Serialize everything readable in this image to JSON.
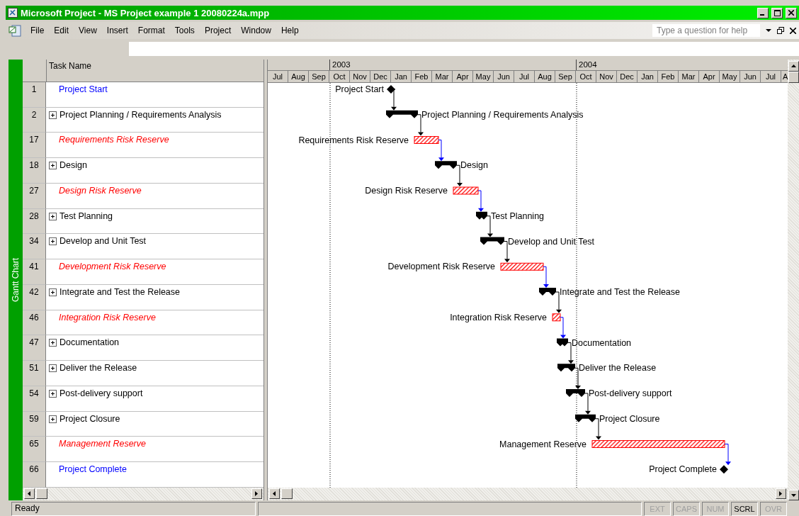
{
  "window": {
    "title": "Microsoft Project - MS Project example 1 20080224a.mpp"
  },
  "menu": [
    "File",
    "Edit",
    "View",
    "Insert",
    "Format",
    "Tools",
    "Project",
    "Window",
    "Help"
  ],
  "help_box": {
    "placeholder": "Type a question for help"
  },
  "view_bar": {
    "label": "Gantt Chart"
  },
  "table": {
    "columns": [
      "Task Name"
    ],
    "rows": [
      {
        "id": "1",
        "name": "Project Start",
        "kind": "milestone"
      },
      {
        "id": "2",
        "name": "Project Planning / Requirements Analysis",
        "kind": "summary",
        "expanded": false
      },
      {
        "id": "17",
        "name": "Requirements Risk Reserve",
        "kind": "reserve"
      },
      {
        "id": "18",
        "name": "Design",
        "kind": "summary",
        "expanded": false
      },
      {
        "id": "27",
        "name": "Design Risk Reserve",
        "kind": "reserve"
      },
      {
        "id": "28",
        "name": "Test Planning",
        "kind": "summary",
        "expanded": false
      },
      {
        "id": "34",
        "name": "Develop and Unit Test",
        "kind": "summary",
        "expanded": false
      },
      {
        "id": "41",
        "name": "Development Risk Reserve",
        "kind": "reserve"
      },
      {
        "id": "42",
        "name": "Integrate and Test the Release",
        "kind": "summary",
        "expanded": false
      },
      {
        "id": "46",
        "name": "Integration Risk Reserve",
        "kind": "reserve"
      },
      {
        "id": "47",
        "name": "Documentation",
        "kind": "summary",
        "expanded": false
      },
      {
        "id": "51",
        "name": "Deliver the Release",
        "kind": "summary",
        "expanded": false
      },
      {
        "id": "54",
        "name": "Post-delivery support",
        "kind": "summary",
        "expanded": false
      },
      {
        "id": "59",
        "name": "Project Closure",
        "kind": "summary",
        "expanded": false
      },
      {
        "id": "65",
        "name": "Management Reserve",
        "kind": "reserve"
      },
      {
        "id": "66",
        "name": "Project Complete",
        "kind": "milestone"
      }
    ]
  },
  "timescale": {
    "years": [
      "2003",
      "2004"
    ],
    "months": [
      "Jul",
      "Aug",
      "Sep",
      "Oct",
      "Nov",
      "Dec",
      "Jan",
      "Feb",
      "Mar",
      "Apr",
      "May",
      "Jun",
      "Jul",
      "Aug",
      "Sep",
      "Oct",
      "Nov",
      "Dec",
      "Jan",
      "Feb",
      "Mar",
      "Apr",
      "May",
      "Jun",
      "Jul",
      "A"
    ]
  },
  "gantt": {
    "bars": [
      {
        "kind": "milestone",
        "label": "Project Start"
      },
      {
        "kind": "summary",
        "label": "Project Planning / Requirements Analysis"
      },
      {
        "kind": "reserve",
        "label": "Requirements Risk Reserve"
      },
      {
        "kind": "summary",
        "label": "Design"
      },
      {
        "kind": "reserve",
        "label": "Design Risk Reserve"
      },
      {
        "kind": "summary",
        "label": "Test Planning"
      },
      {
        "kind": "summary",
        "label": "Develop and Unit Test"
      },
      {
        "kind": "reserve",
        "label": "Development Risk Reserve"
      },
      {
        "kind": "summary",
        "label": "Integrate and Test the Release"
      },
      {
        "kind": "reserve",
        "label": "Integration Risk Reserve"
      },
      {
        "kind": "summary",
        "label": "Documentation"
      },
      {
        "kind": "summary",
        "label": "Deliver the Release"
      },
      {
        "kind": "summary",
        "label": "Post-delivery support"
      },
      {
        "kind": "summary",
        "label": "Project Closure"
      },
      {
        "kind": "reserve",
        "label": "Management Reserve"
      },
      {
        "kind": "milestone",
        "label": "Project Complete"
      }
    ]
  },
  "status_bar": {
    "text": "Ready",
    "indicators": [
      {
        "label": "EXT",
        "on": false
      },
      {
        "label": "CAPS",
        "on": false
      },
      {
        "label": "NUM",
        "on": false
      },
      {
        "label": "SCRL",
        "on": true
      },
      {
        "label": "OVR",
        "on": false
      }
    ]
  }
}
